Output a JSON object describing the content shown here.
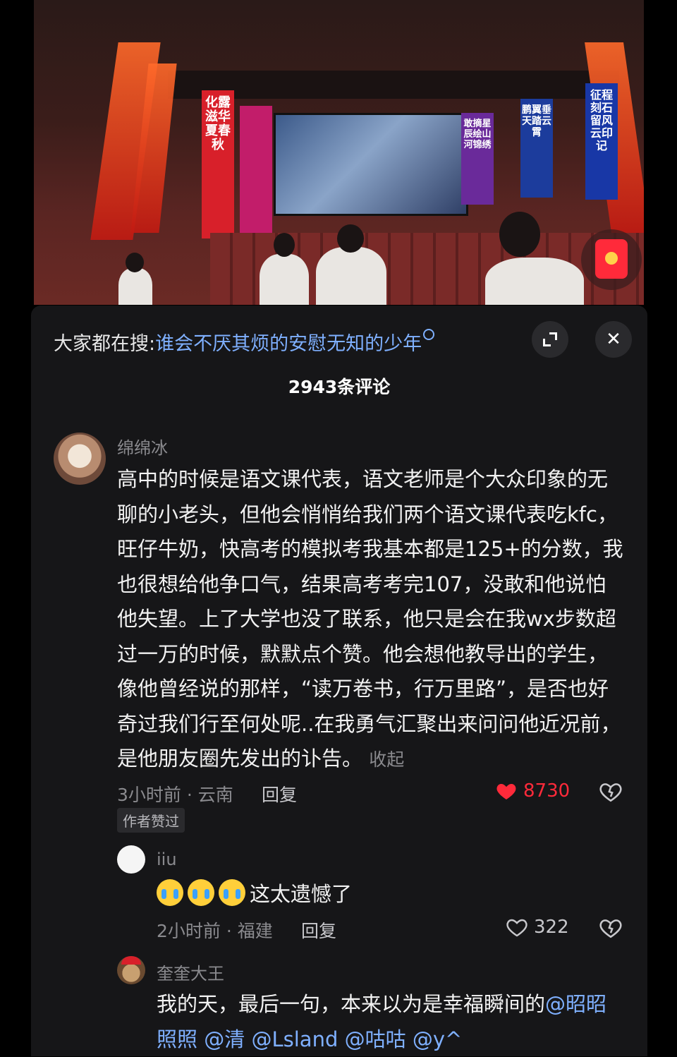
{
  "video": {
    "banners": [
      "化露滋华夏春秋",
      "征程刻石留风云印记",
      "鹏翼垂天踏云霄",
      "敢摘星辰绘山河锦绣"
    ]
  },
  "search": {
    "prefix": "大家都在搜:",
    "term": "谁会不厌其烦的安慰无知的少年"
  },
  "comments_count": "2943条评论",
  "comments": [
    {
      "name": "绵绵冰",
      "text": "高中的时候是语文课代表，语文老师是个大众印象的无聊的小老头，但他会悄悄给我们两个语文课代表吃kfc，旺仔牛奶，快高考的模拟考我基本都是125+的分数，我也很想给他争口气，结果高考考完107，没敢和他说怕他失望。上了大学也没了联系，他只是会在我wx步数超过一万的时候，默默点个赞。他会想他教导出的学生，像他曾经说的那样，“读万卷书，行万里路”，是否也好奇过我们行至何处呢..在我勇气汇聚出来问问他近况前，是他朋友圈先发出的讣告。",
      "collapse": "收起",
      "meta": "3小时前 · 云南",
      "reply": "回复",
      "likes": "8730",
      "badge": "作者赞过"
    },
    {
      "name": "iiu",
      "text": "这太遗憾了",
      "meta": "2小时前 · 福建",
      "reply": "回复",
      "likes": "322"
    },
    {
      "name": "奎奎大王",
      "text": "我的天，最后一句，本来以为是幸福瞬间的",
      "mentions": [
        "@昭昭照照",
        "@清",
        "@Lsland",
        "@咕咕",
        "@y^"
      ]
    }
  ],
  "colors": {
    "accent_link": "#7fb0ff",
    "like_red": "#ff2a3a",
    "sheet_bg": "#161618"
  }
}
